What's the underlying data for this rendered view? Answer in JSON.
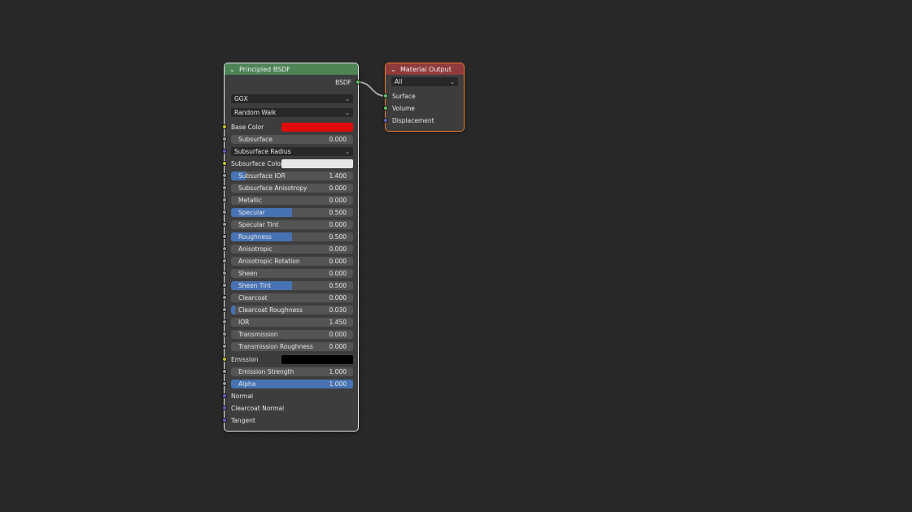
{
  "links_color": "#a6a6a6",
  "principled": {
    "title": "Principled BSDF",
    "header_color": "#4e8456",
    "output_label": "BSDF",
    "distribution": "GGX",
    "subsurface_method": "Random Walk",
    "base_color_label": "Base Color",
    "base_color": "#e00c0c",
    "subsurface_label": "Subsurface",
    "subsurface_value": "0.000",
    "subsurface_fill": 0.0,
    "subsurface_radius": "Subsurface Radius",
    "subsurface_color_label": "Subsurface Color",
    "subsurface_color": "#e6e6e6",
    "fields": [
      {
        "label": "Subsurface IOR",
        "value": "1.400",
        "fill": 0.12
      },
      {
        "label": "Subsurface Anisotropy",
        "value": "0.000",
        "fill": 0.0
      },
      {
        "label": "Metallic",
        "value": "0.000",
        "fill": 0.0
      },
      {
        "label": "Specular",
        "value": "0.500",
        "fill": 0.5
      },
      {
        "label": "Specular Tint",
        "value": "0.000",
        "fill": 0.0
      },
      {
        "label": "Roughness",
        "value": "0.500",
        "fill": 0.5
      },
      {
        "label": "Anisotropic",
        "value": "0.000",
        "fill": 0.0
      },
      {
        "label": "Anisotropic Rotation",
        "value": "0.000",
        "fill": 0.0
      },
      {
        "label": "Sheen",
        "value": "0.000",
        "fill": 0.0
      },
      {
        "label": "Sheen Tint",
        "value": "0.500",
        "fill": 0.5
      },
      {
        "label": "Clearcoat",
        "value": "0.000",
        "fill": 0.0
      },
      {
        "label": "Clearcoat Roughness",
        "value": "0.030",
        "fill": 0.03
      },
      {
        "label": "IOR",
        "value": "1.450",
        "fill": 0.0
      },
      {
        "label": "Transmission",
        "value": "0.000",
        "fill": 0.0
      },
      {
        "label": "Transmission Roughness",
        "value": "0.000",
        "fill": 0.0
      }
    ],
    "emission_label": "Emission",
    "emission_color": "#000000",
    "emission_strength_label": "Emission Strength",
    "emission_strength_value": "1.000",
    "emission_strength_fill": 0.0,
    "alpha_label": "Alpha",
    "alpha_value": "1.000",
    "alpha_fill": 1.0,
    "normal_label": "Normal",
    "clearcoat_normal_label": "Clearcoat Normal",
    "tangent_label": "Tangent"
  },
  "material_output": {
    "title": "Material Output",
    "header_color": "#8f3b3b",
    "target": "All",
    "surface_label": "Surface",
    "volume_label": "Volume",
    "displacement_label": "Displacement"
  }
}
